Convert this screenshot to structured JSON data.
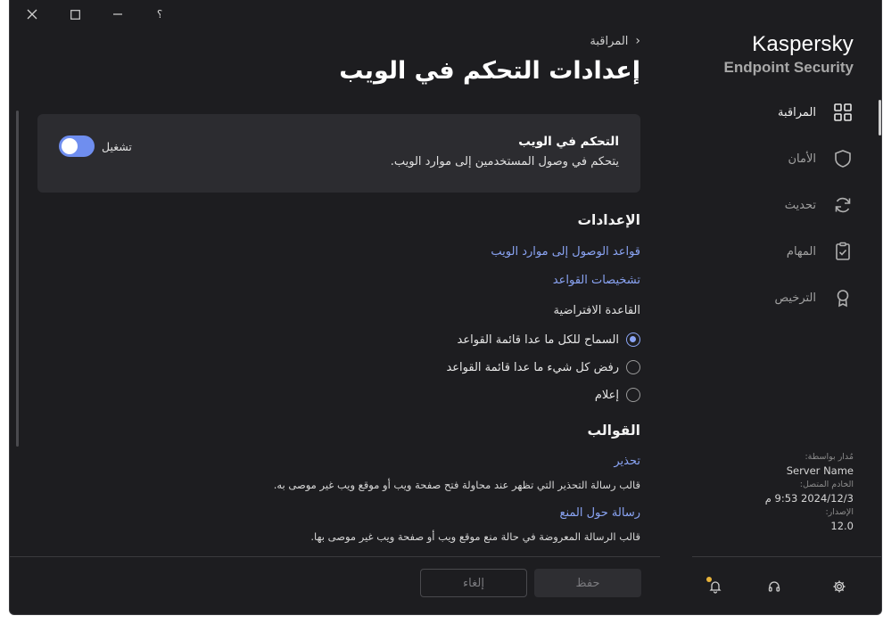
{
  "titlebar": {
    "close": "✕",
    "maximize": "☐",
    "minimize": "—",
    "help": "؟"
  },
  "brand": {
    "line1": "Kaspersky",
    "line2": "Endpoint Security"
  },
  "nav": [
    {
      "label": "المراقبة",
      "icon": "dashboard-icon",
      "active": true
    },
    {
      "label": "الأمان",
      "icon": "shield-icon"
    },
    {
      "label": "تحديث",
      "icon": "refresh-icon"
    },
    {
      "label": "المهام",
      "icon": "tasks-icon"
    },
    {
      "label": "الترخيص",
      "icon": "license-icon"
    }
  ],
  "server": {
    "managed_by_label": "مُدار بواسطة:",
    "managed_by_value": "Server Name",
    "connected_label": "الخادم المتصل:",
    "connected_value": "2024/12/3 9:53 م",
    "version_label": "الإصدار:",
    "version_value": "12.0"
  },
  "main": {
    "breadcrumb": "المراقبة",
    "title": "إعدادات التحكم في الويب",
    "card": {
      "title": "التحكم في الويب",
      "description": "يتحكم في وصول المستخدمين إلى موارد الويب.",
      "toggle_label": "تشغيل",
      "toggle_on": true
    },
    "settings_heading": "الإعدادات",
    "link_access_rules": "قواعد الوصول إلى موارد الويب",
    "link_rule_diagnostics": "تشخيصات القواعد",
    "default_rule_label": "القاعدة الافتراضية",
    "radio_options": [
      {
        "label": "السماح للكل ما عدا قائمة القواعد",
        "checked": true
      },
      {
        "label": "رفض كل شيء ما عدا قائمة القواعد",
        "checked": false
      },
      {
        "label": "إعلام",
        "checked": false
      }
    ],
    "templates_heading": "القوالب",
    "warning_link": "تحذير",
    "warning_desc": "قالب رسالة التحذير التي تظهر عند محاولة فتح صفحة ويب أو موقع ويب غير موصى به.",
    "block_link": "رسالة حول المنع",
    "block_desc": "قالب الرسالة المعروضة في حالة منع موقع ويب أو صفحة ويب غير موصى بها."
  },
  "footer": {
    "save": "حفظ",
    "cancel": "إلغاء"
  },
  "colors": {
    "accent": "#6f8eef",
    "link": "#8aa4f4",
    "background": "#1d1d20",
    "card": "#2c2c30",
    "notification_dot": "#e8b33a"
  }
}
